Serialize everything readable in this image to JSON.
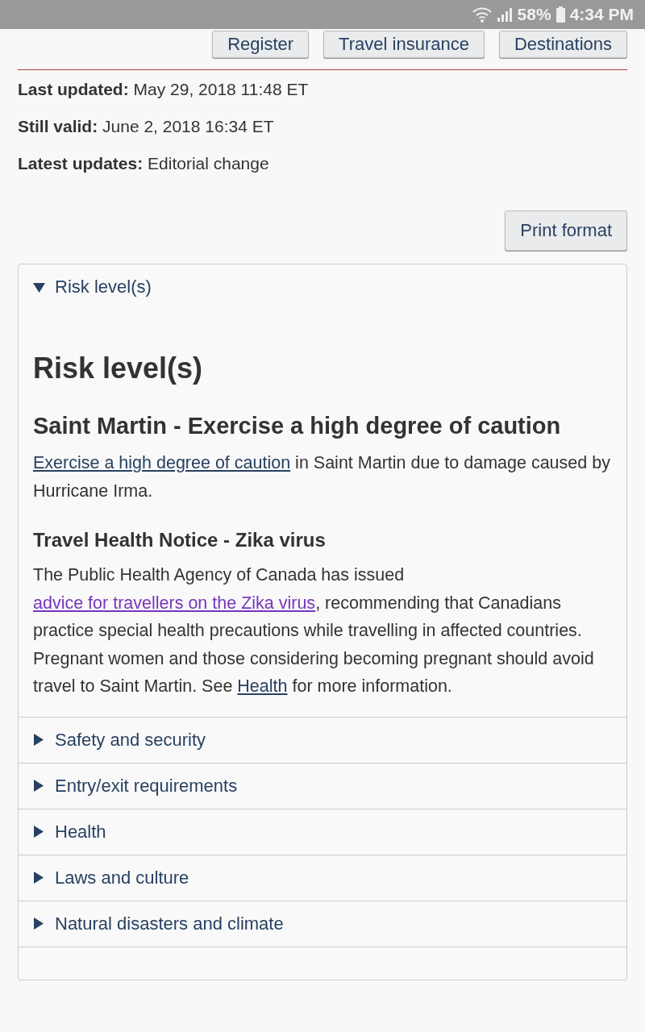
{
  "status_bar": {
    "battery": "58%",
    "time": "4:34 PM"
  },
  "nav_buttons": [
    "Register",
    "Travel insurance",
    "Destinations"
  ],
  "meta": [
    {
      "label": "Last updated:",
      "value": "May 29, 2018 11:48 ET"
    },
    {
      "label": "Still valid:",
      "value": "June 2, 2018 16:34 ET"
    },
    {
      "label": "Latest updates:",
      "value": "Editorial change"
    }
  ],
  "print_button": "Print format",
  "sections": [
    {
      "title": "Risk level(s)",
      "expanded": true,
      "heading": "Risk level(s)",
      "blocks": [
        {
          "kind": "subheading",
          "text": "Saint Martin - Exercise a high degree of caution"
        },
        {
          "kind": "paragraph",
          "parts": [
            {
              "link": "Exercise a high degree of caution",
              "visited": false
            },
            {
              "text": " in Saint Martin due to damage caused by Hurricane Irma."
            }
          ]
        },
        {
          "kind": "minor_heading",
          "text": "Travel Health Notice - Zika virus"
        },
        {
          "kind": "paragraph",
          "parts": [
            {
              "text": "The Public Health Agency of Canada has issued "
            },
            {
              "link": "advice for travellers on the Zika virus",
              "visited": true
            },
            {
              "text": ", recommending that Canadians practice special health precautions while travelling in affected countries. Pregnant women and those considering becoming pregnant should avoid travel to Saint Martin. See "
            },
            {
              "link": "Health",
              "visited": false
            },
            {
              "text": " for more information."
            }
          ]
        }
      ]
    },
    {
      "title": "Safety and security",
      "expanded": false
    },
    {
      "title": "Entry/exit requirements",
      "expanded": false
    },
    {
      "title": "Health",
      "expanded": false
    },
    {
      "title": "Laws and culture",
      "expanded": false
    },
    {
      "title": "Natural disasters and climate",
      "expanded": false
    }
  ]
}
